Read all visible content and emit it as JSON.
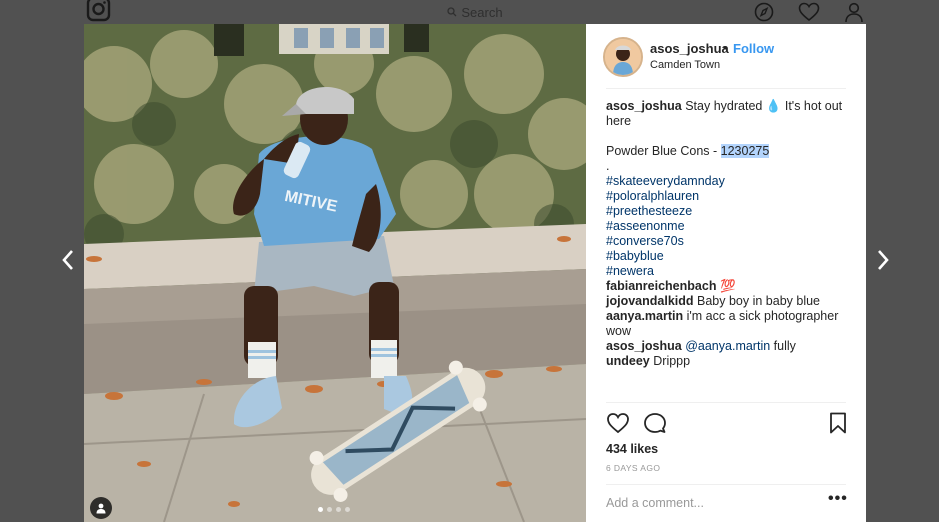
{
  "topbar": {
    "search_placeholder": "Search"
  },
  "post": {
    "username": "asos_joshua",
    "separator": "•",
    "follow_label": "Follow",
    "location": "Camden Town",
    "caption": {
      "username": "asos_joshua",
      "text": "Stay hydrated 💧 It's hot out here",
      "product_line": "Powder Blue Cons - ",
      "product_code": "1230275",
      "dot": ".",
      "hashtags": [
        "#skateeverydamnday",
        "#poloralphlauren",
        "#preethesteeze",
        "#asseenonme",
        "#converse70s",
        "#babyblue",
        "#newera"
      ]
    },
    "comments": [
      {
        "user": "fabianreichenbach",
        "text": "💯"
      },
      {
        "user": "jojovandalkidd",
        "text": "Baby boy in baby blue"
      },
      {
        "user": "aanya.martin",
        "text": "i'm acc a sick photographer wow"
      },
      {
        "user": "asos_joshua",
        "mention": "@aanya.martin",
        "text": " fully"
      },
      {
        "user": "undeey",
        "text": "Drippp"
      }
    ],
    "likes": "434 likes",
    "date": "6 DAYS AGO",
    "add_comment_placeholder": "Add a comment...",
    "more_label": "•••"
  },
  "carousel": {
    "count": 4,
    "active": 1
  },
  "colors": {
    "link": "#3897f0",
    "hashtag": "#003569",
    "overlay": "#515151",
    "selection": "#b3d4fc"
  }
}
